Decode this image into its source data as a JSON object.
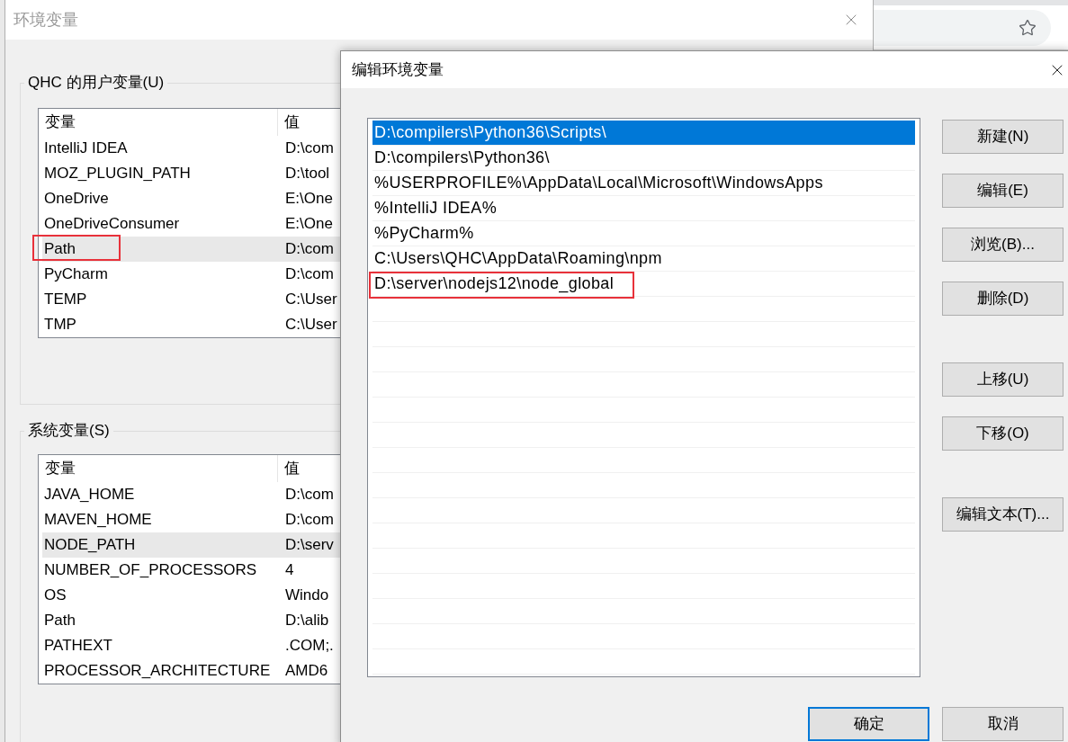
{
  "settings_window": {
    "title": "环境变量",
    "user_variables": {
      "label": "QHC 的用户变量(U)",
      "columns": [
        "变量",
        "值"
      ],
      "rows": [
        {
          "variable": "IntelliJ IDEA",
          "value": "D:\\com",
          "selected": false,
          "marked": false
        },
        {
          "variable": "MOZ_PLUGIN_PATH",
          "value": "D:\\tool",
          "selected": false,
          "marked": false
        },
        {
          "variable": "OneDrive",
          "value": "E:\\One",
          "selected": false,
          "marked": false
        },
        {
          "variable": "OneDriveConsumer",
          "value": "E:\\One",
          "selected": false,
          "marked": false
        },
        {
          "variable": "Path",
          "value": "D:\\com",
          "selected": true,
          "marked": true
        },
        {
          "variable": "PyCharm",
          "value": "D:\\com",
          "selected": false,
          "marked": false
        },
        {
          "variable": "TEMP",
          "value": "C:\\User",
          "selected": false,
          "marked": false
        },
        {
          "variable": "TMP",
          "value": "C:\\User",
          "selected": false,
          "marked": false
        }
      ]
    },
    "system_variables": {
      "label": "系统变量(S)",
      "columns": [
        "变量",
        "值"
      ],
      "rows": [
        {
          "variable": "JAVA_HOME",
          "value": "D:\\com",
          "selected": false,
          "marked": false
        },
        {
          "variable": "MAVEN_HOME",
          "value": "D:\\com",
          "selected": false,
          "marked": false
        },
        {
          "variable": "NODE_PATH",
          "value": "D:\\serv",
          "selected": true,
          "marked": false
        },
        {
          "variable": "NUMBER_OF_PROCESSORS",
          "value": "4",
          "selected": false,
          "marked": false
        },
        {
          "variable": "OS",
          "value": "Windo",
          "selected": false,
          "marked": false
        },
        {
          "variable": "Path",
          "value": "D:\\alib",
          "selected": false,
          "marked": false
        },
        {
          "variable": "PATHEXT",
          "value": ".COM;.",
          "selected": false,
          "marked": false
        },
        {
          "variable": "PROCESSOR_ARCHITECTURE",
          "value": "AMD6",
          "selected": false,
          "marked": false
        }
      ]
    }
  },
  "edit_dialog": {
    "title": "编辑环境变量",
    "entries": [
      {
        "text": "D:\\compilers\\Python36\\Scripts\\",
        "selected": true,
        "marked": false
      },
      {
        "text": "D:\\compilers\\Python36\\",
        "selected": false,
        "marked": false
      },
      {
        "text": "%USERPROFILE%\\AppData\\Local\\Microsoft\\WindowsApps",
        "selected": false,
        "marked": false
      },
      {
        "text": "%IntelliJ IDEA%",
        "selected": false,
        "marked": false
      },
      {
        "text": "%PyCharm%",
        "selected": false,
        "marked": false
      },
      {
        "text": "C:\\Users\\QHC\\AppData\\Roaming\\npm",
        "selected": false,
        "marked": false
      },
      {
        "text": "D:\\server\\nodejs12\\node_global",
        "selected": false,
        "marked": true
      }
    ],
    "button_groups": [
      [
        "新建(N)",
        "编辑(E)",
        "浏览(B)...",
        "删除(D)"
      ],
      [
        "上移(U)",
        "下移(O)"
      ],
      [
        "编辑文本(T)..."
      ]
    ],
    "footer_buttons": [
      {
        "label": "确定",
        "default": true
      },
      {
        "label": "取消",
        "default": false
      }
    ]
  }
}
